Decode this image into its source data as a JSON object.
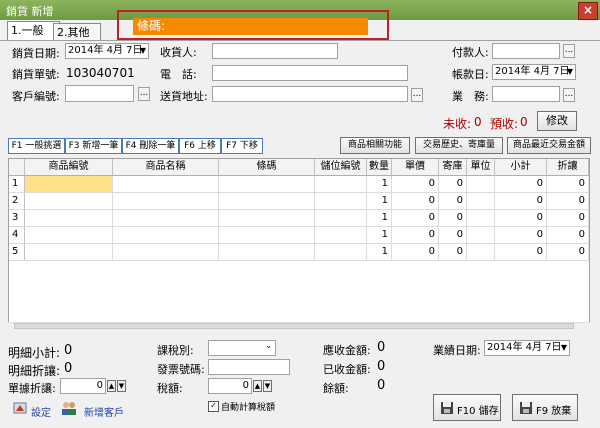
{
  "window": {
    "title": "銷貨 新增",
    "close": "×"
  },
  "tabs": [
    {
      "label": "1.一般"
    },
    {
      "label": "2.其他"
    }
  ],
  "barcode": {
    "label": "條碼:"
  },
  "header": {
    "sale_date_label": "銷貨日期:",
    "sale_date_value": "2014年 4月 7日",
    "sale_no_label": "銷貨單號:",
    "sale_no_value": "103040701",
    "customer_label": "客戶編號:",
    "receiver_label": "收貨人:",
    "phone_label": "電　話:",
    "address_label": "送貨地址:",
    "payer_label": "付款人:",
    "account_date_label": "帳款日:",
    "account_date_value": "2014年 4月 7日",
    "sales_label": "業　務:",
    "unreceived_label": "未收:",
    "unreceived_value": "0",
    "prepaid_label": "預收:",
    "prepaid_value": "0",
    "modify_button": "修改",
    "dots": "..."
  },
  "toolbar": {
    "f1": "F1 一般挑選",
    "f3": "F3 新增一筆",
    "f4": "F4 刪除一筆",
    "f6": "F6 上移",
    "f7": "F7 下移",
    "related": "商品相關功能",
    "history": "交易歷史、寄庫量",
    "recent": "商品最近交易金額"
  },
  "grid": {
    "columns": [
      "商品編號",
      "商品名稱",
      "條碼",
      "儲位編號",
      "數量",
      "單價",
      "寄庫",
      "單位",
      "小計",
      "折讓"
    ],
    "rows": [
      {
        "no": "1",
        "qty": "1",
        "price": "0",
        "consign": "0",
        "subtotal": "0",
        "discount": "0"
      },
      {
        "no": "2",
        "qty": "1",
        "price": "0",
        "consign": "0",
        "subtotal": "0",
        "discount": "0"
      },
      {
        "no": "3",
        "qty": "1",
        "price": "0",
        "consign": "0",
        "subtotal": "0",
        "discount": "0"
      },
      {
        "no": "4",
        "qty": "1",
        "price": "0",
        "consign": "0",
        "subtotal": "0",
        "discount": "0"
      },
      {
        "no": "5",
        "qty": "1",
        "price": "0",
        "consign": "0",
        "subtotal": "0",
        "discount": "0"
      }
    ]
  },
  "footer": {
    "detail_subtotal_label": "明細小計:",
    "detail_subtotal_value": "0",
    "detail_discount_label": "明細折讓:",
    "detail_discount_value": "0",
    "bill_discount_label": "單據折讓:",
    "bill_discount_value": "0",
    "tax_type_label": "課稅別:",
    "invoice_no_label": "發票號碼:",
    "tax_amount_label": "稅額:",
    "tax_amount_value": "0",
    "auto_tax_label": "自動計算稅額",
    "receivable_label": "應收金額:",
    "receivable_value": "0",
    "received_label": "已收金額:",
    "received_value": "0",
    "balance_label": "餘額:",
    "balance_value": "0",
    "perf_date_label": "業績日期:",
    "perf_date_value": "2014年 4月 7日",
    "settings_label": "設定",
    "add_customer_label": "新增客戶",
    "save_button": "F10 儲存",
    "discard_button": "F9 放棄"
  }
}
